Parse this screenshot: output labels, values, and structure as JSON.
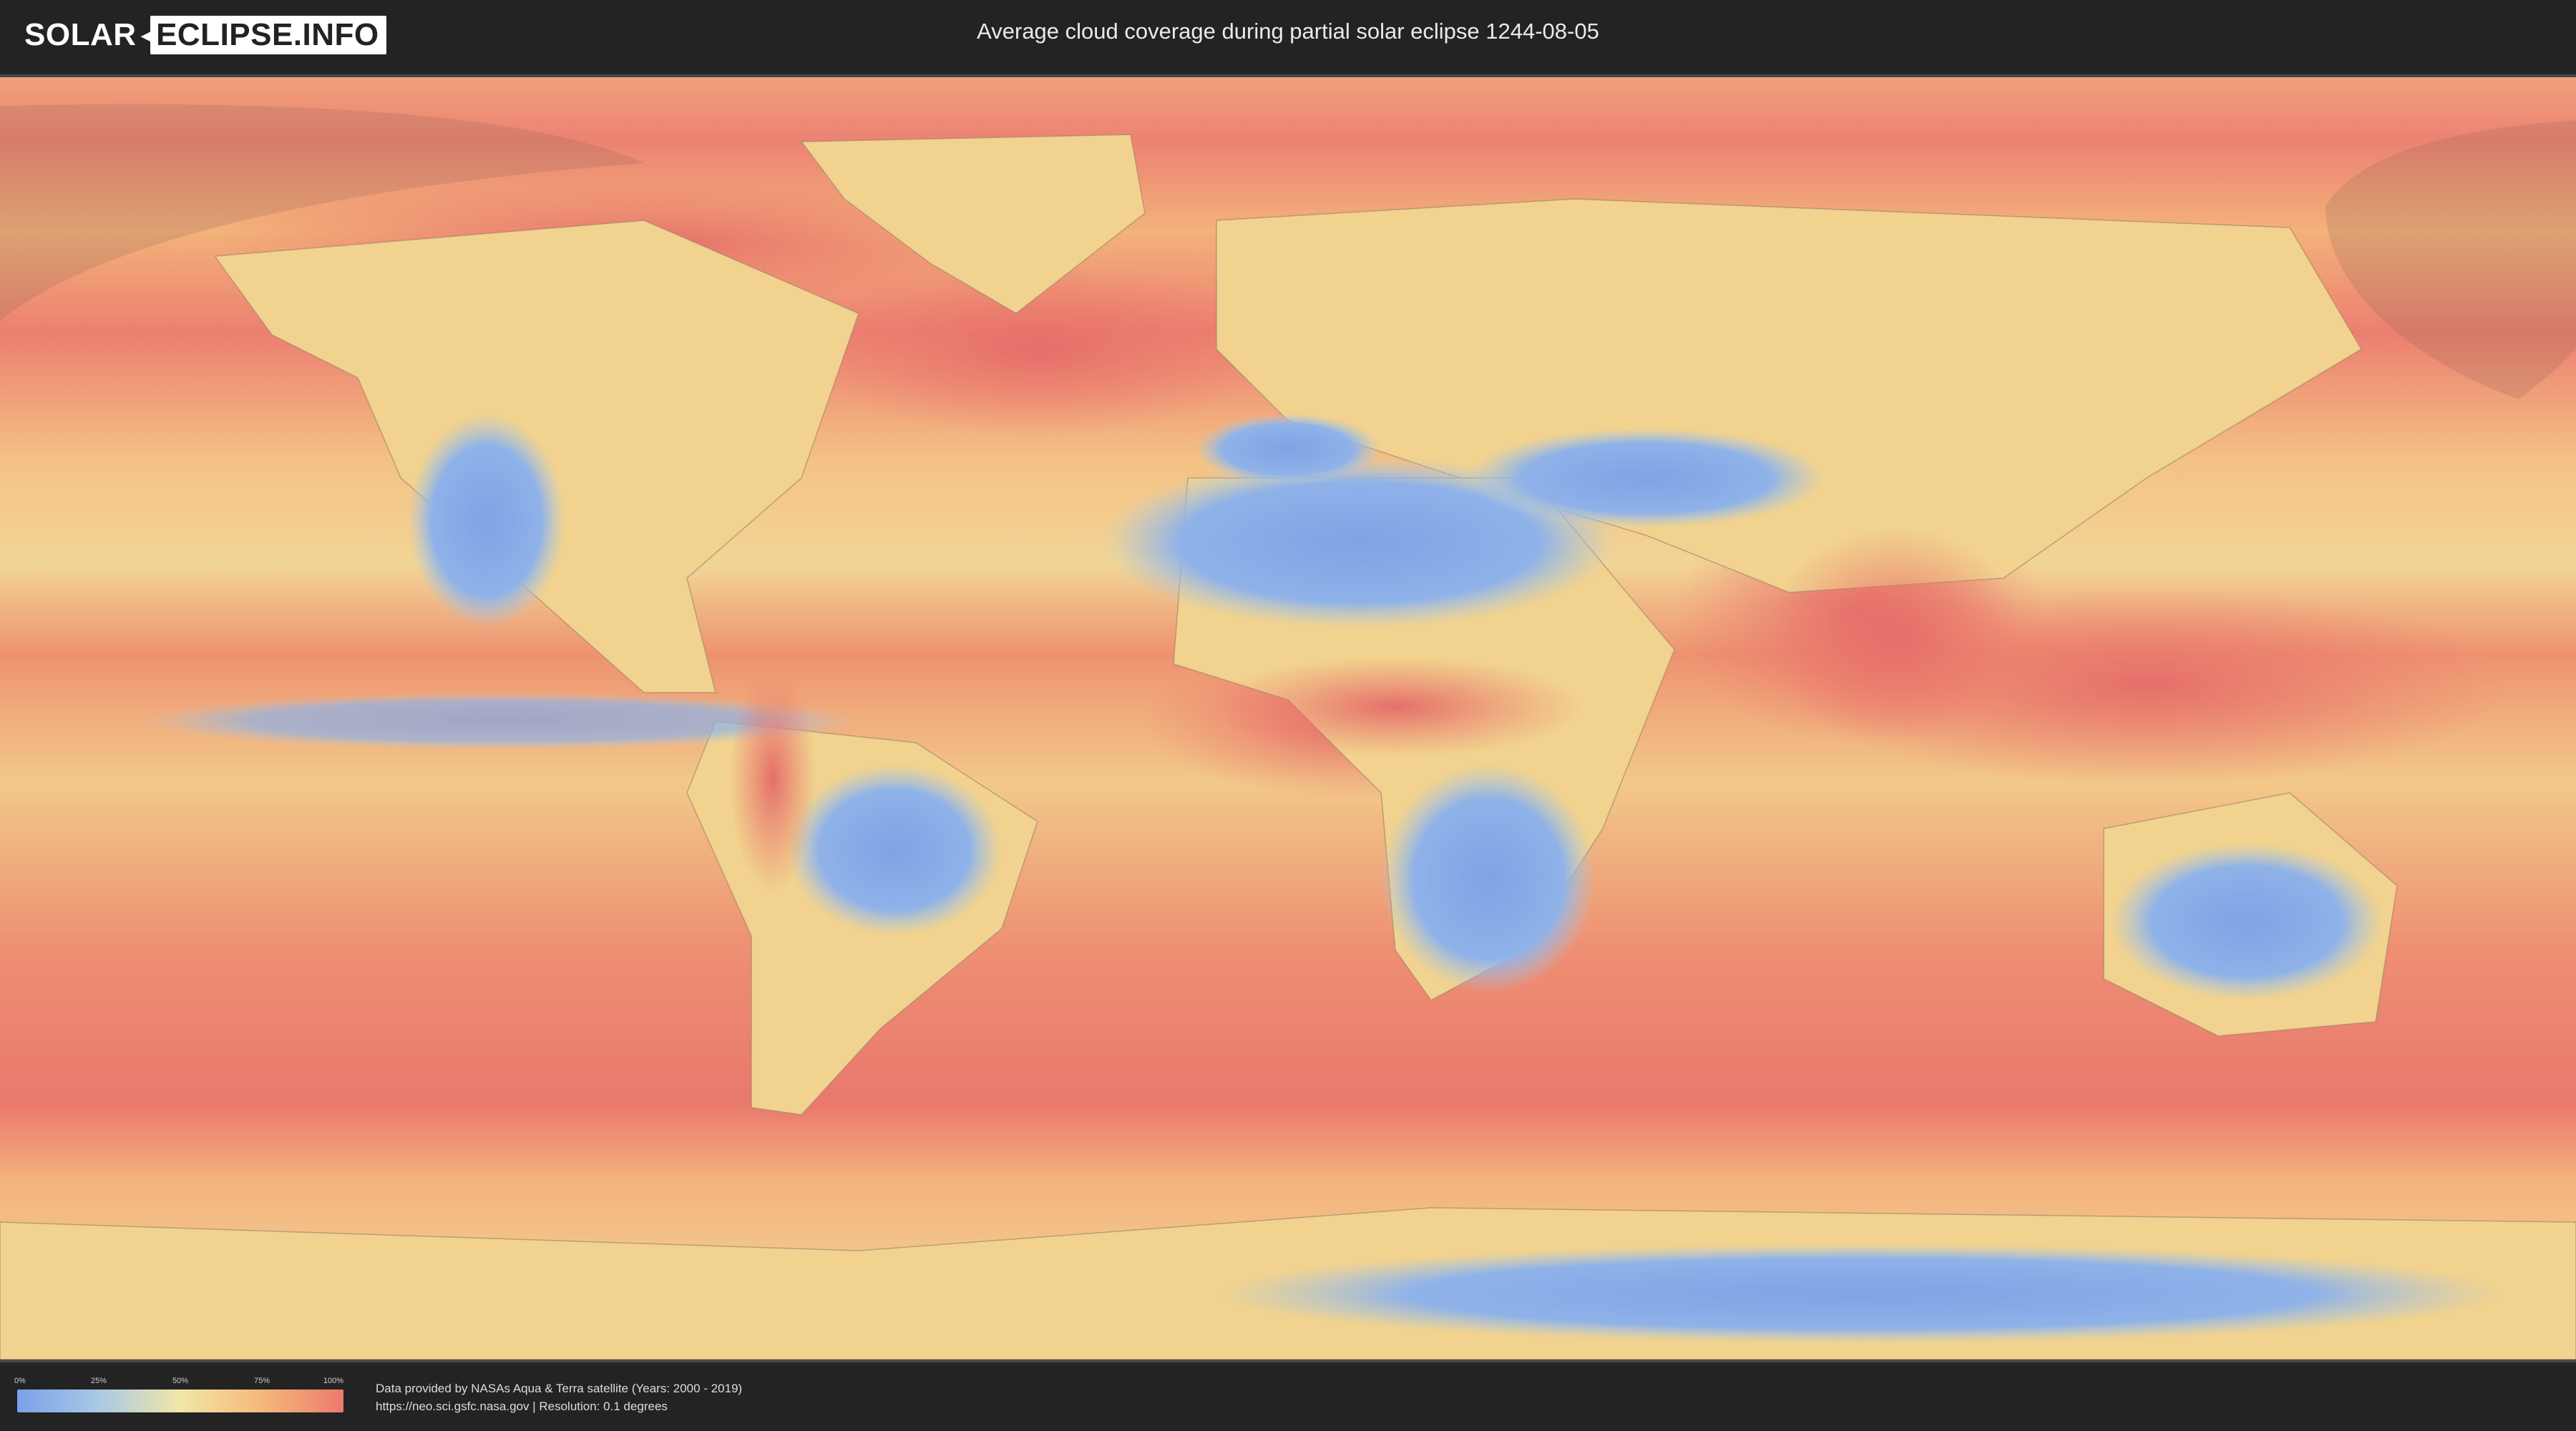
{
  "header": {
    "logo_left": "SOLAR",
    "logo_right": "ECLIPSE.INFO",
    "title": "Average cloud coverage during partial solar eclipse 1244-08-05"
  },
  "map": {
    "description_colors": {
      "clear": "#7aa0e8",
      "low": "#a9c9e6",
      "mid": "#f2e6a6",
      "high": "#f4b979",
      "overcast": "#ec7a6e"
    },
    "eclipse_shadow_color": "#8c6450"
  },
  "legend": {
    "ticks": [
      "0%",
      "25%",
      "50%",
      "75%",
      "100%"
    ],
    "gradient_colors": [
      "#7aa0e8",
      "#a9c9e6",
      "#f2e6a6",
      "#f4b979",
      "#ec7a6e"
    ]
  },
  "footer": {
    "credit_line1": "Data provided by NASAs Aqua & Terra satellite (Years: 2000 - 2019)",
    "credit_line2": "https://neo.sci.gsfc.nasa.gov | Resolution: 0.1 degrees"
  }
}
